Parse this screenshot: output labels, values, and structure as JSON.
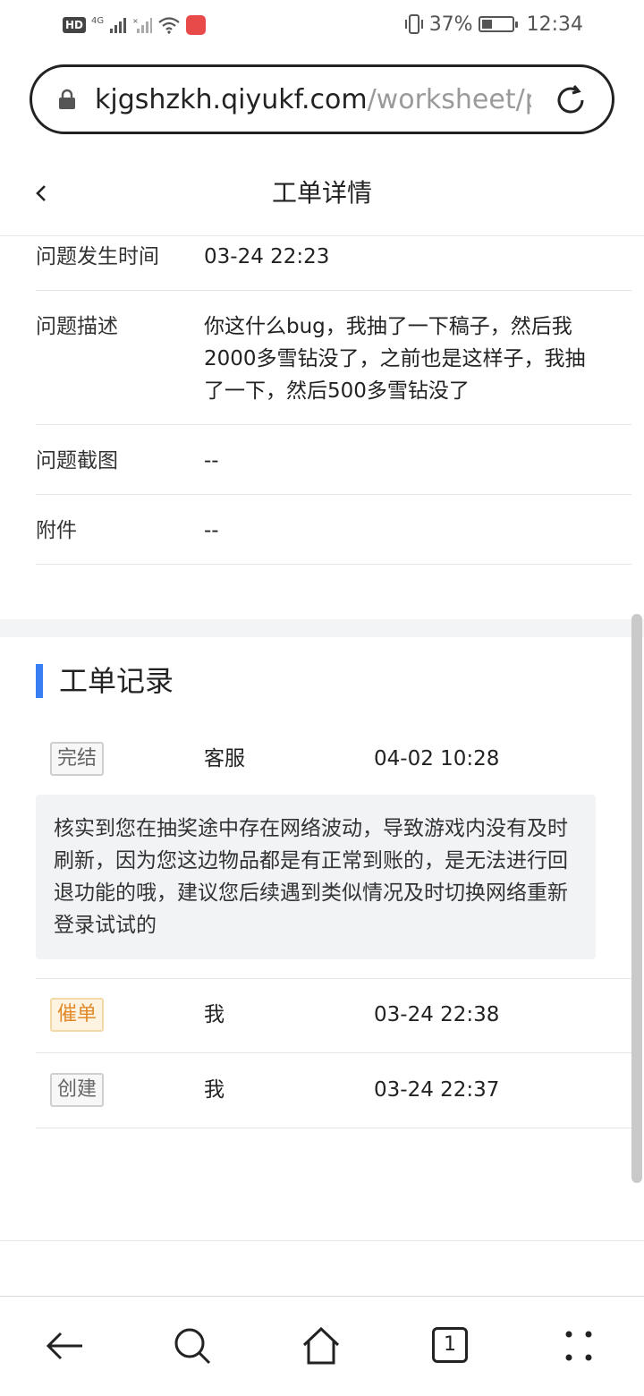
{
  "status_bar": {
    "network_type": "4G",
    "hd_label": "HD",
    "battery_percent": "37%",
    "battery_level": 0.37,
    "time": "12:34"
  },
  "address_bar": {
    "url_host": "kjgshzkh.qiyukf.com",
    "url_path": "/worksheet/pa",
    "icons": [
      "lock-icon",
      "reload-icon"
    ]
  },
  "header": {
    "title": "工单详情",
    "back_icon": "chevron-left-icon"
  },
  "details": {
    "time_label": "问题发生时间",
    "time_value": "03-24 22:23",
    "desc_label": "问题描述",
    "desc_value": "你这什么bug，我抽了一下稿子，然后我2000多雪钻没了，之前也是这样子，我抽了一下，然后500多雪钻没了",
    "screenshot_label": "问题截图",
    "screenshot_value": "--",
    "attachment_label": "附件",
    "attachment_value": "--"
  },
  "records": {
    "title": "工单记录",
    "accent_color": "#3a7ef3",
    "items": [
      {
        "tag": "完结",
        "actor": "客服",
        "time": "04-02 10:28",
        "note": "核实到您在抽奖途中存在网络波动，导致游戏内没有及时刷新，因为您这边物品都是有正常到账的，是无法进行回退功能的哦，建议您后续遇到类似情况及时切换网络重新登录试试的"
      },
      {
        "tag": "催单",
        "actor": "我",
        "time": "03-24 22:38"
      },
      {
        "tag": "创建",
        "actor": "我",
        "time": "03-24 22:37"
      }
    ]
  },
  "bottom_nav": {
    "tab_count": "1",
    "icons": [
      "back-arrow-icon",
      "search-icon",
      "home-icon",
      "tabs-icon",
      "more-icon"
    ]
  }
}
